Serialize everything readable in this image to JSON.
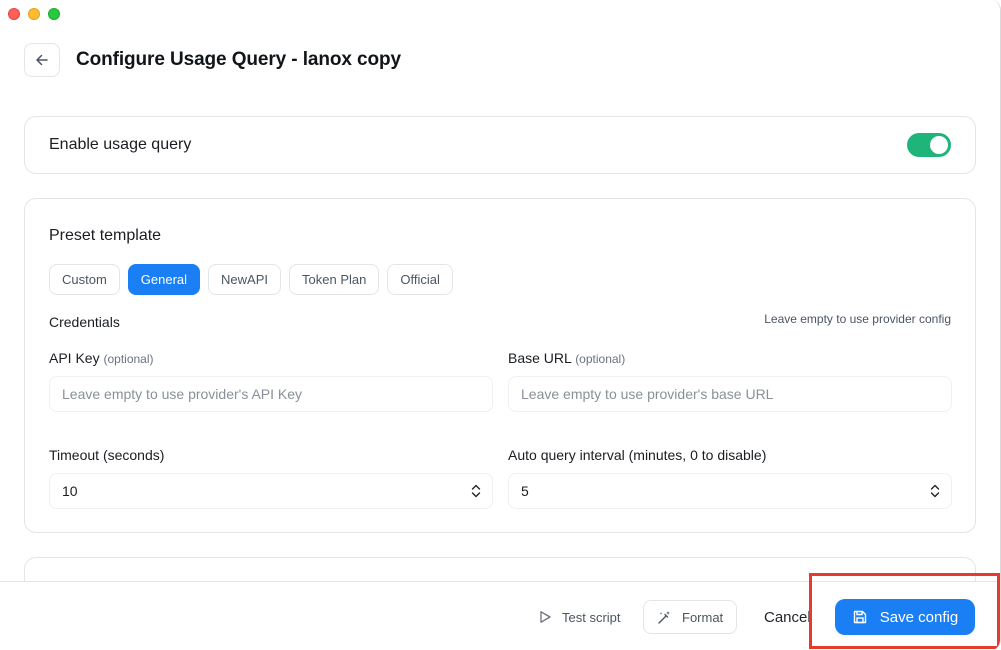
{
  "window": {
    "title": "Configure Usage Query - lanox copy"
  },
  "enable": {
    "label": "Enable usage query",
    "enabled": true,
    "toggle_color": "#1fb57a"
  },
  "preset": {
    "title": "Preset template",
    "tabs": [
      {
        "label": "Custom",
        "active": false
      },
      {
        "label": "General",
        "active": true
      },
      {
        "label": "NewAPI",
        "active": false
      },
      {
        "label": "Token Plan",
        "active": false
      },
      {
        "label": "Official",
        "active": false
      }
    ],
    "credentials_label": "Credentials",
    "credentials_hint": "Leave empty to use provider config",
    "api_key": {
      "label": "API Key",
      "optional": "(optional)",
      "value": "",
      "placeholder": "Leave empty to use provider's API Key"
    },
    "base_url": {
      "label": "Base URL",
      "optional": "(optional)",
      "value": "",
      "placeholder": "Leave empty to use provider's base URL"
    },
    "timeout": {
      "label": "Timeout (seconds)",
      "value": "10"
    },
    "interval": {
      "label": "Auto query interval (minutes, 0 to disable)",
      "value": "5"
    }
  },
  "footer": {
    "test_label": "Test script",
    "format_label": "Format",
    "cancel_label": "Cancel",
    "save_label": "Save config"
  },
  "colors": {
    "accent": "#1a7ef5",
    "highlight": "#e53b2e"
  }
}
